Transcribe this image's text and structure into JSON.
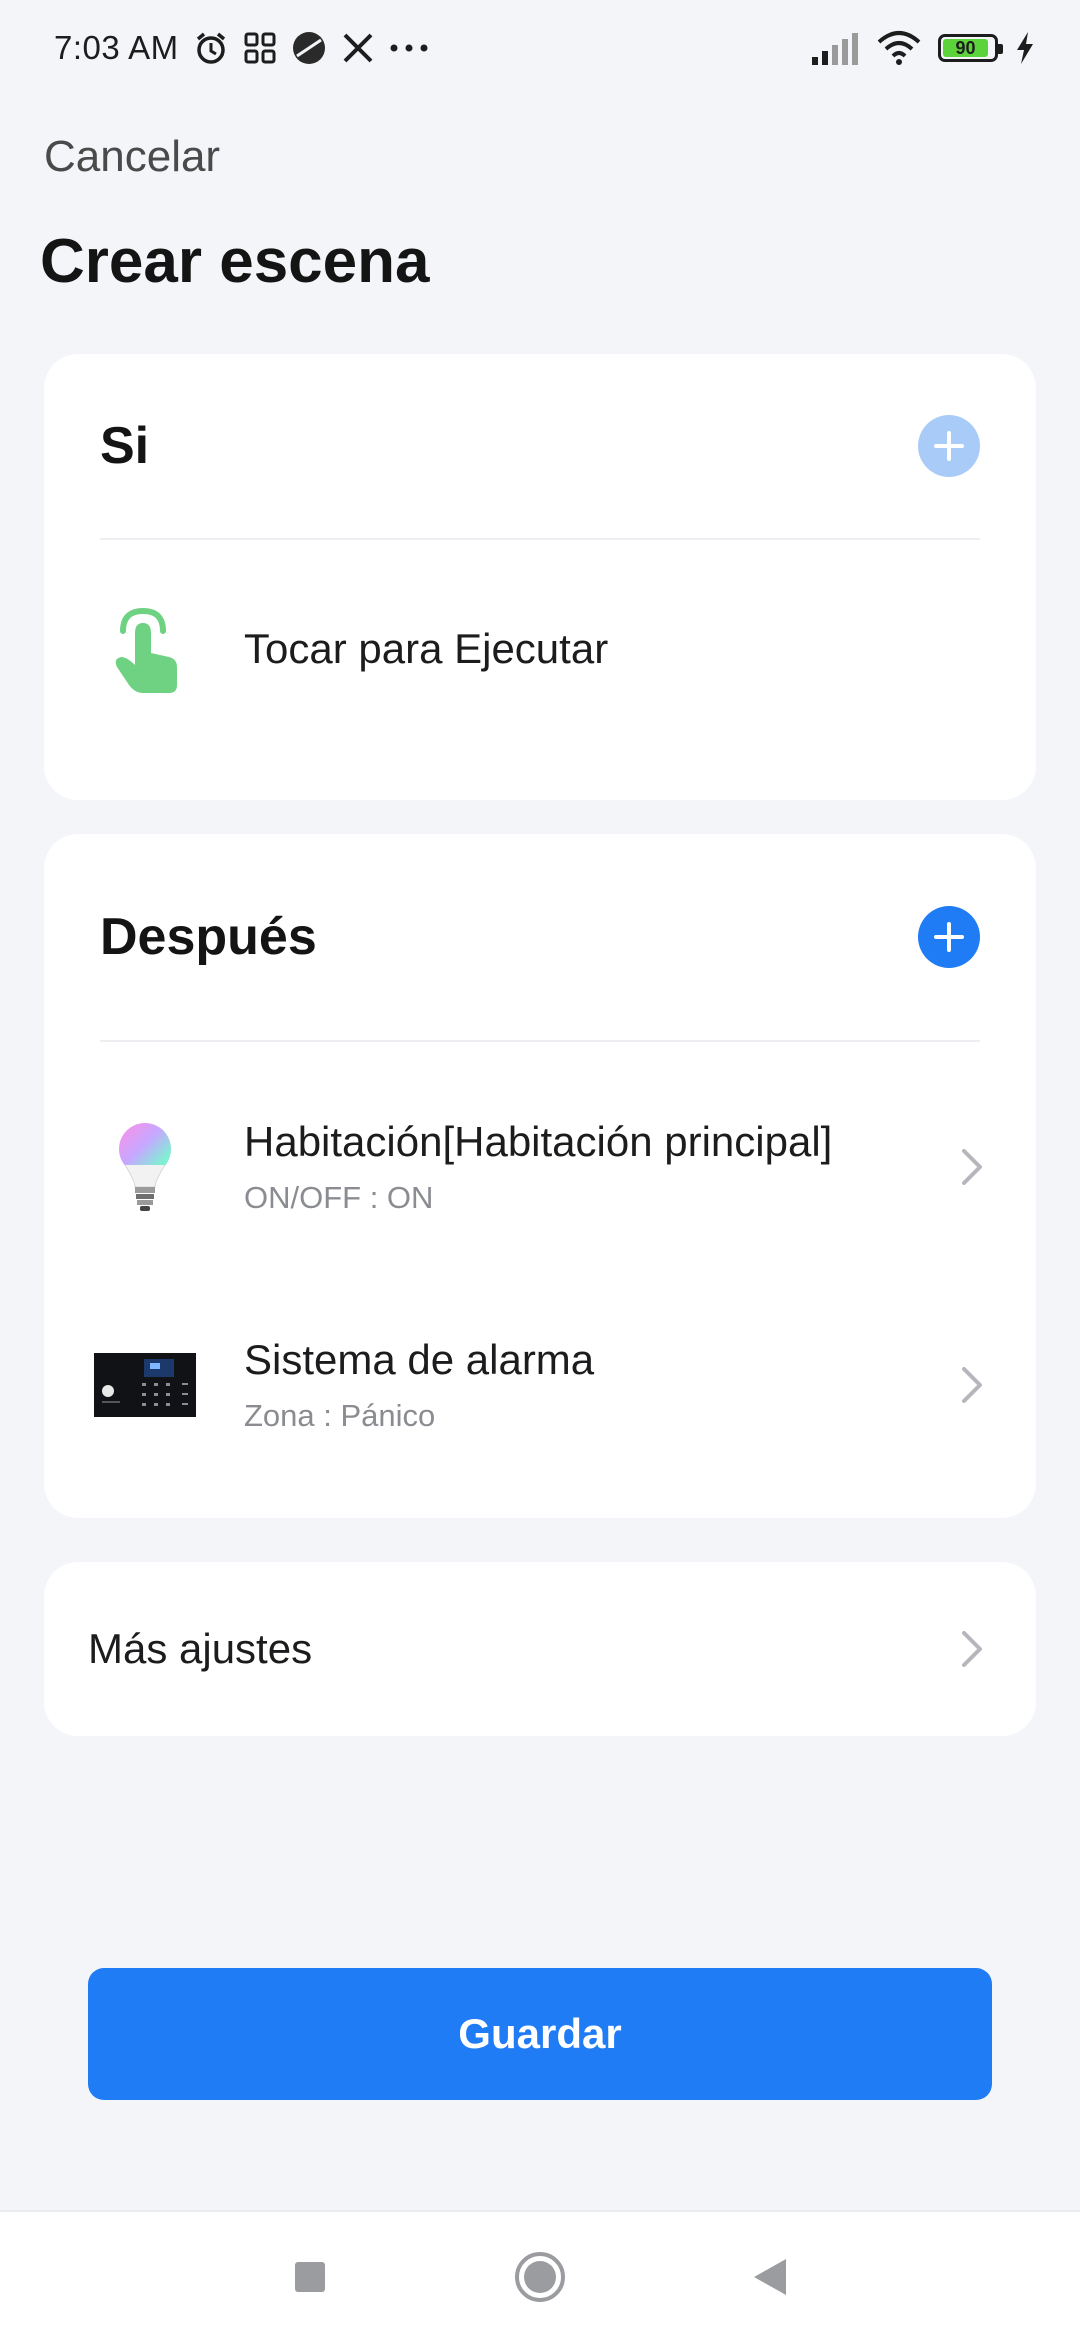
{
  "status_bar": {
    "time": "7:03 AM",
    "battery_level": "90",
    "icons": [
      "alarm-icon",
      "apps-grid-icon",
      "orb-app-icon",
      "x-app-icon",
      "more-dots-icon",
      "signal-icon",
      "wifi-icon",
      "battery-icon",
      "charging-icon"
    ],
    "battery_color": "#5cd33a"
  },
  "header": {
    "cancel_label": "Cancelar",
    "title": "Crear escena"
  },
  "if_section": {
    "title": "Si",
    "add_icon": "plus-icon",
    "add_state": "disabled",
    "items": [
      {
        "icon": "tap-hand-icon",
        "title": "Tocar para Ejecutar"
      }
    ]
  },
  "then_section": {
    "title": "Después",
    "add_icon": "plus-icon",
    "add_state": "enabled",
    "items": [
      {
        "icon": "smart-bulb-icon",
        "title": "Habitación[Habitación principal]",
        "subtitle": "ON/OFF : ON"
      },
      {
        "icon": "alarm-panel-icon",
        "title": "Sistema de alarma",
        "subtitle": "Zona : Pánico"
      }
    ]
  },
  "more_settings": {
    "label": "Más ajustes"
  },
  "save_label": "Guardar",
  "nav_bar": {
    "buttons": [
      "recents-square-icon",
      "home-circle-icon",
      "back-triangle-icon"
    ]
  },
  "colors": {
    "accent": "#1f7cf5",
    "accent_disabled": "#a9cbf7",
    "background": "#f3f5f9",
    "tap_icon": "#6fd283"
  }
}
